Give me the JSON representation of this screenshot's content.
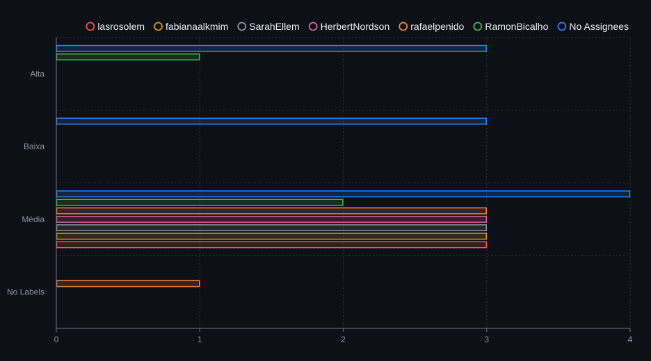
{
  "chart_data": {
    "type": "bar",
    "orientation": "horizontal",
    "categories": [
      "Alta",
      "Baixa",
      "Média",
      "No Labels"
    ],
    "series": [
      {
        "name": "lasrosolem",
        "color": "#f85149",
        "values": [
          0,
          0,
          3,
          0
        ]
      },
      {
        "name": "fabianaalkmim",
        "color": "#d29922",
        "values": [
          0,
          0,
          3,
          0
        ]
      },
      {
        "name": "SarahEllem",
        "color": "#8b949e",
        "values": [
          0,
          0,
          3,
          0
        ]
      },
      {
        "name": "HerbertNordson",
        "color": "#db61a2",
        "values": [
          0,
          0,
          3,
          0
        ]
      },
      {
        "name": "rafaelpenido",
        "color": "#f0883e",
        "values": [
          0,
          0,
          3,
          1
        ]
      },
      {
        "name": "RamonBicalho",
        "color": "#3fb950",
        "values": [
          1,
          0,
          2,
          0
        ]
      },
      {
        "name": "No Assignees",
        "color": "#2f81f7",
        "values": [
          3,
          3,
          4,
          0
        ]
      }
    ],
    "xlim": [
      0,
      4
    ],
    "xticks": [
      0,
      1,
      2,
      3,
      4
    ],
    "title": "",
    "xlabel": "",
    "ylabel": "",
    "grid": true,
    "legend_position": "top-right"
  }
}
